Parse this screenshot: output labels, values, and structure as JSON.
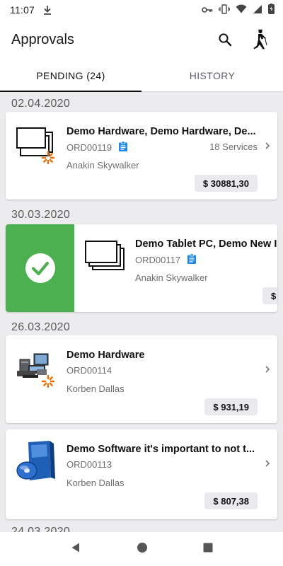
{
  "status_bar": {
    "time": "11:07"
  },
  "app_bar": {
    "title": "Approvals"
  },
  "tabs": [
    {
      "label": "PENDING (24)",
      "active": true
    },
    {
      "label": "HISTORY",
      "active": false
    }
  ],
  "groups": [
    {
      "date": "02.04.2020"
    },
    {
      "date": "30.03.2020"
    },
    {
      "date": "26.03.2020"
    },
    {
      "date": "24.03.2020"
    }
  ],
  "cards": [
    {
      "name": "Demo Hardware, Demo Hardware, De...",
      "order": "ORD00119",
      "services": "18 Services",
      "requester": "Anakin Skywalker",
      "price": "$ 30881,30",
      "thumb": "stacked-monitors-icon",
      "has_doc": true
    },
    {
      "name": "Demo Tablet PC, Demo New I",
      "order": "ORD00117",
      "services": "",
      "requester": "Anakin Skywalker",
      "price": "$",
      "thumb": "stacked-tablets-icon",
      "has_doc": true
    },
    {
      "name": "Demo Hardware",
      "order": "ORD00114",
      "services": "",
      "requester": "Korben Dallas",
      "price": "$ 931,19",
      "thumb": "hardware-photo-icon",
      "has_doc": false
    },
    {
      "name": "Demo Software it's important to not t...",
      "order": "ORD00113",
      "services": "",
      "requester": "Korben Dallas",
      "price": "$ 807,38",
      "thumb": "software-box-icon",
      "has_doc": false
    }
  ],
  "colors": {
    "approve": "#4caf50",
    "accent_orange": "#ef6c00",
    "doc_blue": "#1e88e5"
  }
}
